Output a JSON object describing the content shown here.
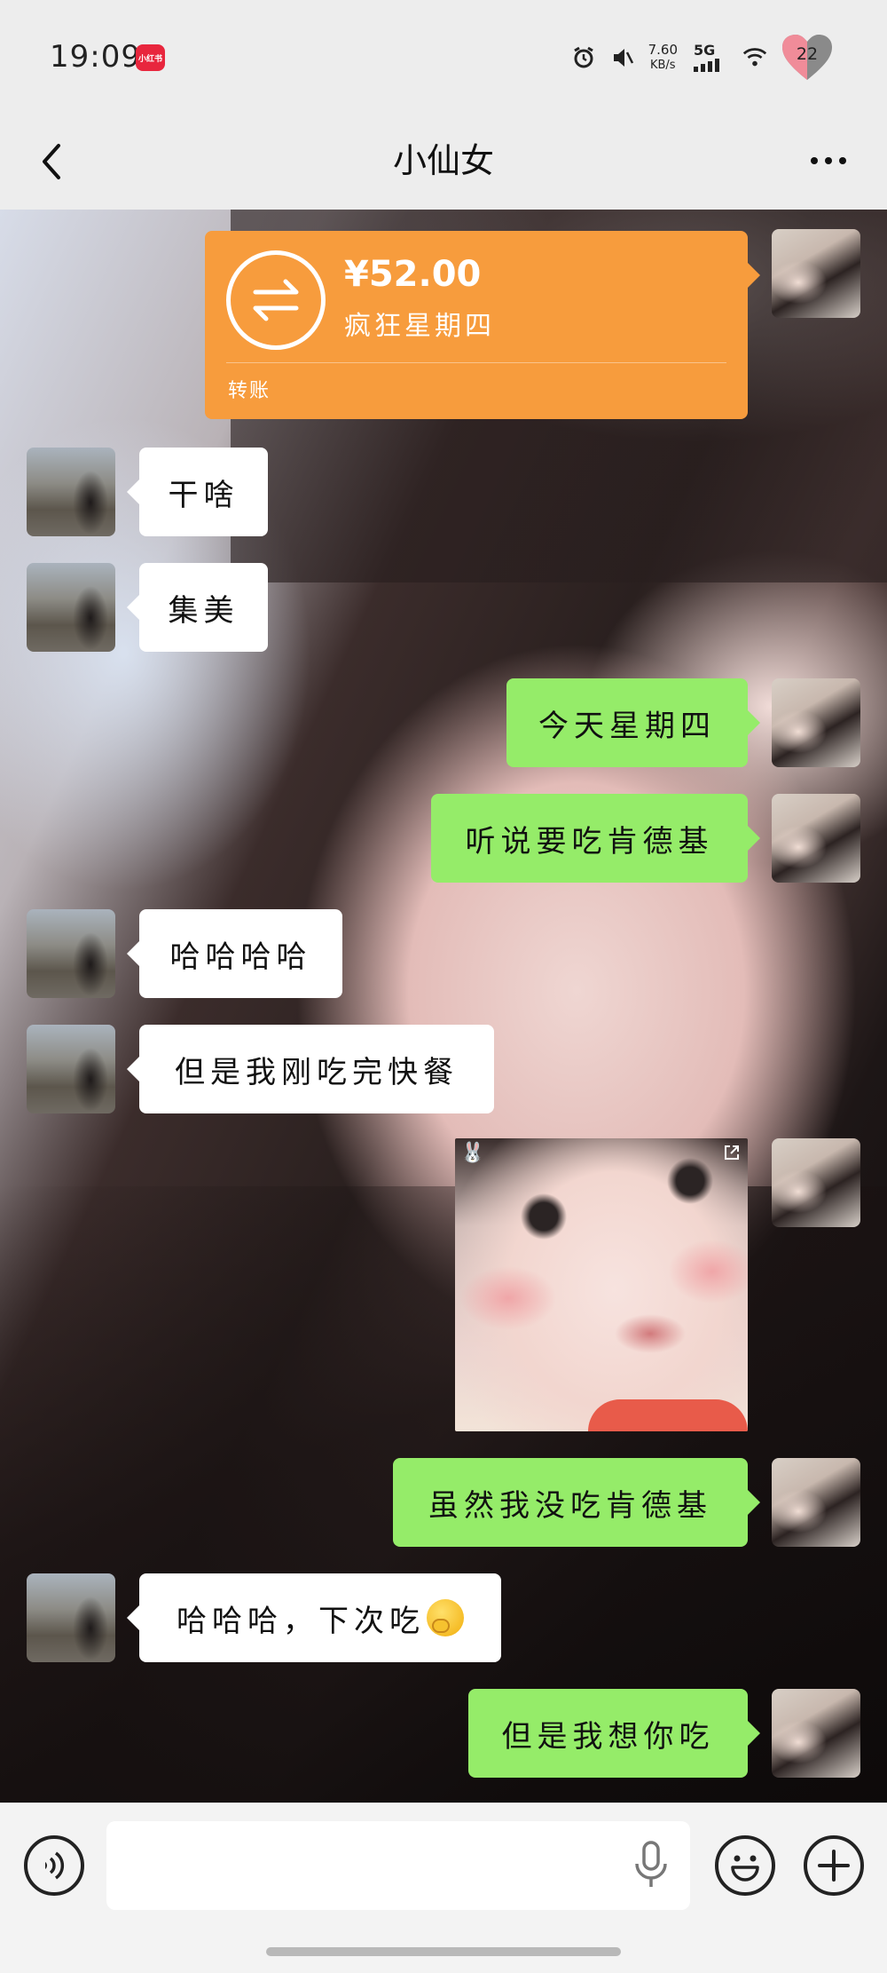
{
  "status_bar": {
    "time": "19:09",
    "app_badge": "小红书",
    "net_speed_value": "7.60",
    "net_speed_unit": "KB/s",
    "network": "5G",
    "battery_level": "22"
  },
  "header": {
    "title": "小仙女",
    "back_icon": "chevron-left-icon",
    "more_icon": "more-dots-icon"
  },
  "messages": {
    "transfer": {
      "amount": "¥52.00",
      "note": "疯狂星期四",
      "type_label": "转账"
    },
    "m1": "干啥",
    "m2": "集美",
    "m3": "今天星期四",
    "m4": "听说要吃肯德基",
    "m5": "哈哈哈哈",
    "m6": "但是我刚吃完快餐",
    "m8": "虽然我没吃肯德基",
    "m9": "哈哈哈，下次吃",
    "m10": "但是我想你吃"
  },
  "colors": {
    "outgoing_bubble": "#95ec69",
    "incoming_bubble": "#ffffff",
    "transfer_card": "#f79c3d"
  },
  "bottom_bar": {
    "voice_icon": "voice-icon",
    "mic_icon": "microphone-icon",
    "emoji_icon": "smiley-icon",
    "plus_icon": "plus-icon"
  }
}
